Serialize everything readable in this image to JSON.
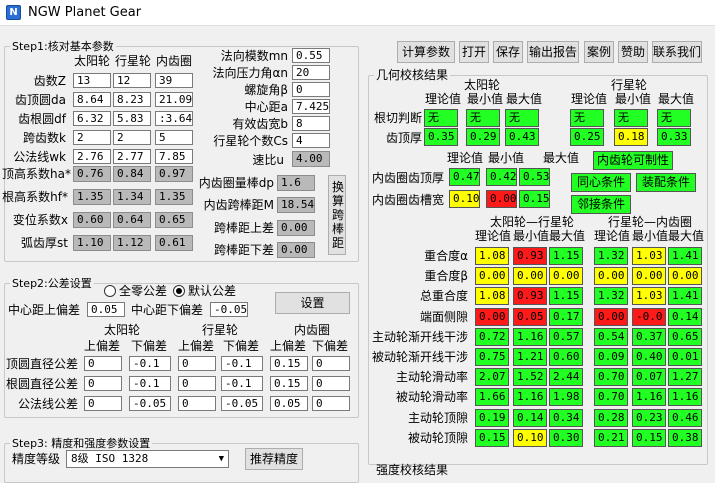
{
  "window": {
    "title": "NGW Planet Gear",
    "icon_text": "N"
  },
  "toolbar": {
    "items": [
      "计算参数",
      "打开",
      "保存",
      "输出报告",
      "案例",
      "赞助",
      "联系我们"
    ]
  },
  "step1": {
    "title": "Step1:核对基本参数",
    "cols": [
      "太阳轮",
      "行星轮",
      "内齿圈"
    ],
    "rows": [
      {
        "label": "齿数Z",
        "values": [
          "13",
          "12",
          "39"
        ]
      },
      {
        "label": "齿顶圆da",
        "values": [
          "8.64",
          "8.23",
          "21.09"
        ]
      },
      {
        "label": "齿根圆df",
        "values": [
          "6.32",
          "5.83",
          ":3.646"
        ]
      },
      {
        "label": "跨齿数k",
        "values": [
          "2",
          "2",
          "5"
        ]
      },
      {
        "label": "公法线wk",
        "values": [
          "2.76",
          "2.77",
          "7.85"
        ]
      }
    ],
    "ro_rows": [
      {
        "label": "顶高系数ha*",
        "values": [
          "0.76",
          "0.84",
          "0.97"
        ]
      },
      {
        "label": "根高系数hf*",
        "values": [
          "1.35",
          "1.34",
          "1.35"
        ]
      },
      {
        "label": "变位系数x",
        "values": [
          "0.60",
          "0.64",
          "0.65"
        ]
      },
      {
        "label": "弧齿厚st",
        "values": [
          "1.10",
          "1.12",
          "0.61"
        ]
      }
    ],
    "params": [
      {
        "label": "法向模数mn",
        "value": "0.55"
      },
      {
        "label": "法向压力角αn",
        "value": "20"
      },
      {
        "label": "螺旋角β",
        "value": "0"
      },
      {
        "label": "中心距a",
        "value": "7.425"
      },
      {
        "label": "有效齿宽b",
        "value": "8"
      },
      {
        "label": "行星轮个数Cs",
        "value": "4"
      }
    ],
    "speed_ratio": {
      "label": "速比u",
      "value": "4.00"
    },
    "measure": [
      {
        "label": "内齿圈量棒dp",
        "value": "1.6"
      },
      {
        "label": "内齿跨棒距M",
        "value": "18.54"
      },
      {
        "label": "跨棒距上差",
        "value": "0.00"
      },
      {
        "label": "跨棒距下差",
        "value": "0.00"
      }
    ],
    "calc_button": "换算跨棒距"
  },
  "step2": {
    "title": "Step2:公差设置",
    "radio_zero": "全零公差",
    "radio_default": "默认公差",
    "center_upper_label": "中心距上偏差",
    "center_upper": "0.05",
    "center_lower_label": "中心距下偏差",
    "center_lower": "-0.05",
    "set_button": "设置",
    "gear_headers": [
      "太阳轮",
      "行星轮",
      "内齿圈"
    ],
    "sub_headers": [
      "上偏差",
      "下偏差"
    ],
    "rows": [
      {
        "label": "顶圆直径公差",
        "values": [
          "0",
          "-0.1",
          "0",
          "-0.1",
          "0.15",
          "0"
        ]
      },
      {
        "label": "根圆直径公差",
        "values": [
          "0",
          "-0.1",
          "0",
          "-0.1",
          "0.15",
          "0"
        ]
      },
      {
        "label": "公法线公差",
        "values": [
          "0",
          "-0.05",
          "0",
          "-0.05",
          "0.05",
          "0"
        ]
      }
    ]
  },
  "step3": {
    "title": "Step3: 精度和强度参数设置",
    "grade_label": "精度等级",
    "grade_value": "8级 ISO 1328",
    "recommend_button": "推荐精度"
  },
  "geo": {
    "title": "几何校核结果",
    "sun": "太阳轮",
    "planet": "行星轮",
    "hdr": [
      "理论值",
      "最小值",
      "最大值"
    ],
    "undercut_label": "根切判断",
    "undercut": [
      "无",
      "无",
      "无",
      "无",
      "无",
      "无"
    ],
    "tip_label": "齿顶厚",
    "tip": [
      "0.35",
      "0.29",
      "0.43",
      "0.25",
      "0.18",
      "0.33"
    ],
    "ring_hdr": [
      "理论值",
      "最小值",
      "最大值"
    ],
    "ring_tip_label": "内齿圈齿顶厚",
    "ring_tip": [
      "0.47",
      "0.42",
      "0.53"
    ],
    "ring_slot_label": "内齿圈齿槽宽",
    "ring_slot": [
      "0.10",
      "0.00",
      "0.15"
    ],
    "btn_ring": "内齿轮可制性",
    "btn_coaxial": "同心条件",
    "btn_assembly": "装配条件",
    "btn_adjacent": "邻接条件",
    "pair1": "太阳轮—行星轮",
    "pair2": "行星轮—内齿圈",
    "hdr2": [
      "理论值",
      "最小值",
      "最大值",
      "理论值",
      "最小值",
      "最大值"
    ],
    "rows": [
      {
        "label": "重合度α",
        "values": [
          "1.08",
          "0.93",
          "1.15",
          "1.32",
          "1.03",
          "1.41"
        ]
      },
      {
        "label": "重合度β",
        "values": [
          "0.00",
          "0.00",
          "0.00",
          "0.00",
          "0.00",
          "0.00"
        ]
      },
      {
        "label": "总重合度",
        "values": [
          "1.08",
          "0.93",
          "1.15",
          "1.32",
          "1.03",
          "1.41"
        ]
      },
      {
        "label": "端面侧隙",
        "values": [
          "0.00",
          "0.05",
          "0.17",
          "0.00",
          "-0.0",
          "0.14"
        ]
      },
      {
        "label": "主动轮渐开线干涉",
        "values": [
          "0.72",
          "1.16",
          "0.57",
          "0.54",
          "0.37",
          "0.65"
        ]
      },
      {
        "label": "被动轮渐开线干涉",
        "values": [
          "0.75",
          "1.21",
          "0.60",
          "0.09",
          "0.40",
          "0.01"
        ]
      },
      {
        "label": "主动轮滑动率",
        "values": [
          "2.07",
          "1.52",
          "2.44",
          "0.70",
          "0.07",
          "1.27"
        ]
      },
      {
        "label": "被动轮滑动率",
        "values": [
          "1.66",
          "1.16",
          "1.98",
          "0.70",
          "1.16",
          "1.16"
        ]
      },
      {
        "label": "主动轮顶隙",
        "values": [
          "0.19",
          "0.14",
          "0.34",
          "0.28",
          "0.23",
          "0.46"
        ]
      },
      {
        "label": "被动轮顶隙",
        "values": [
          "0.15",
          "0.10",
          "0.30",
          "0.21",
          "0.15",
          "0.38"
        ]
      }
    ],
    "colors": [
      [
        "y",
        "rd",
        "g",
        "g",
        "y",
        "g"
      ],
      [
        "y",
        "y",
        "y",
        "y",
        "y",
        "y"
      ],
      [
        "y",
        "rd",
        "g",
        "g",
        "y",
        "g"
      ],
      [
        "rd",
        "rd",
        "g",
        "rd",
        "rd",
        "g"
      ],
      [
        "g",
        "g",
        "g",
        "g",
        "g",
        "g"
      ],
      [
        "g",
        "g",
        "g",
        "g",
        "g",
        "g"
      ],
      [
        "g",
        "g",
        "g",
        "g",
        "g",
        "g"
      ],
      [
        "g",
        "g",
        "g",
        "g",
        "g",
        "g"
      ],
      [
        "g",
        "g",
        "g",
        "g",
        "g",
        "g"
      ],
      [
        "g",
        "y",
        "g",
        "g",
        "g",
        "g"
      ]
    ]
  },
  "strength": {
    "title": "强度校核结果"
  }
}
